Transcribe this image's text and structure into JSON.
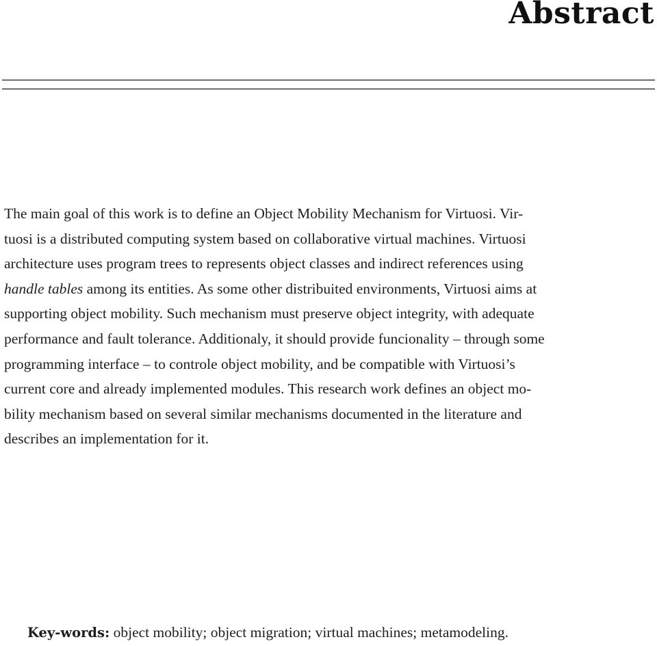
{
  "heading": {
    "title": "Abstract"
  },
  "abstract": {
    "lines": [
      "The main goal of this work is to define an Object Mobility Mechanism for Virtuosi. Vir-",
      "tuosi is a distributed computing system based on collaborative virtual machines. Virtuosi",
      "architecture uses program trees to represents object classes and indirect references using",
      {
        "italic": "handle tables",
        "rest": " among its entities. As some other distribuited environments, Virtuosi aims at"
      },
      "supporting object mobility. Such mechanism must preserve object integrity, with adequate",
      "performance and fault tolerance. Additionaly, it should provide funcionality – through some",
      "programming interface – to controle object mobility, and be compatible with Virtuosi’s",
      "current core and already implemented modules. This research work defines an object mo-",
      "bility mechanism based on several similar mechanisms documented in the literature and",
      "describes an implementation for it."
    ]
  },
  "keywords": {
    "label": "Key-words:",
    "text": " object mobility; object migration; virtual machines; metamodeling."
  }
}
